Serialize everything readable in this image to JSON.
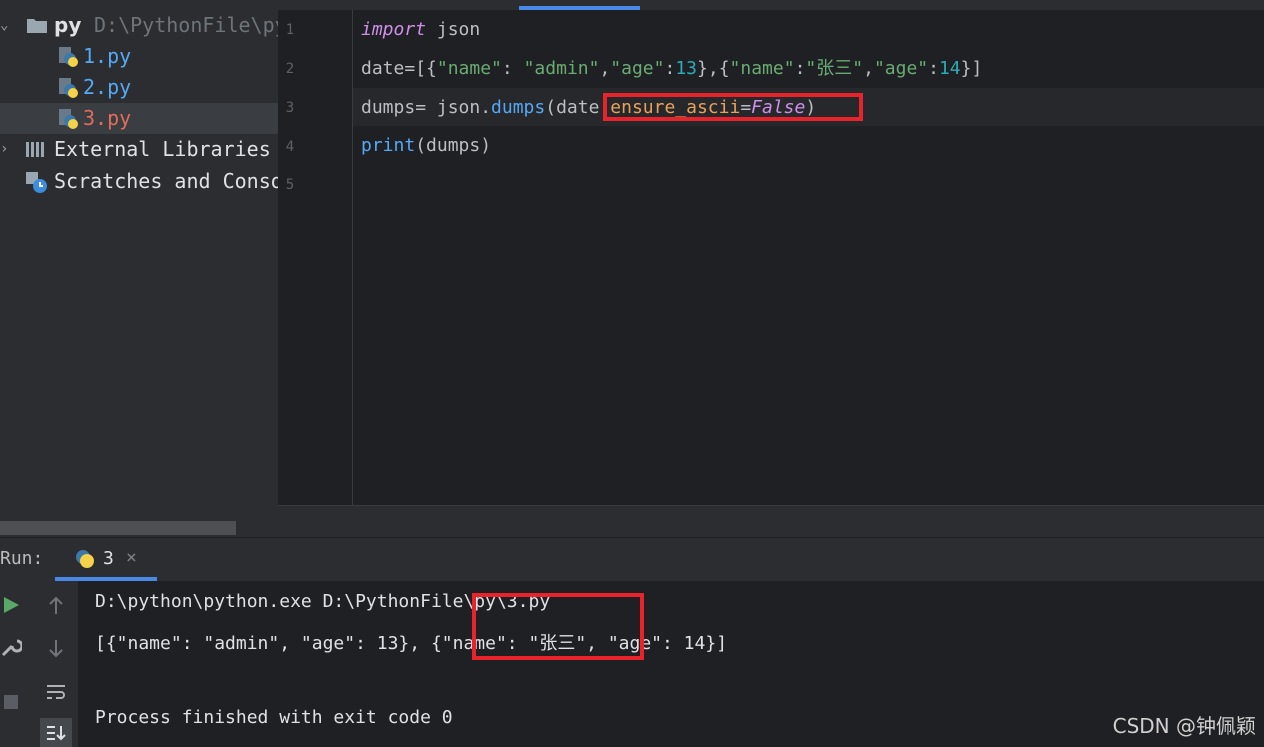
{
  "project": {
    "root_name": "py",
    "root_path": "D:\\PythonFile\\py",
    "files": [
      {
        "name": "1.py"
      },
      {
        "name": "2.py"
      },
      {
        "name": "3.py"
      }
    ],
    "external_libraries": "External Libraries",
    "scratches": "Scratches and Consoles"
  },
  "editor": {
    "line_numbers": [
      "1",
      "2",
      "3",
      "4",
      "5"
    ],
    "code": {
      "l1_kw": "import",
      "l1_rest": " json",
      "l2_a": "date",
      "l2_b": "=[{",
      "l2_s1": "\"name\"",
      "l2_c": ": ",
      "l2_s2": "\"admin\"",
      "l2_d": ",",
      "l2_s3": "\"age\"",
      "l2_e": ":",
      "l2_n1": "13",
      "l2_f": "},{",
      "l2_s4": "\"name\"",
      "l2_g": ":",
      "l2_s5": "\"张三\"",
      "l2_h": ",",
      "l2_s6": "\"age\"",
      "l2_i": ":",
      "l2_n2": "14",
      "l2_j": "}]",
      "l3_a": "dumps",
      "l3_b": "= json.",
      "l3_fn": "dumps",
      "l3_c": "(date,",
      "l3_param": "ensure_ascii",
      "l3_d": "=",
      "l3_kw": "False",
      "l3_e": ")",
      "l4_fn": "print",
      "l4_rest": "(dumps)"
    }
  },
  "run": {
    "label": "Run:",
    "tab_name": "3",
    "console_lines": [
      "D:\\python\\python.exe D:\\PythonFile\\py\\3.py",
      "[{\"name\": \"admin\", \"age\": 13}, {\"name\": \"张三\", \"age\": 14}]",
      "",
      "Process finished with exit code 0"
    ]
  },
  "watermark": "CSDN @钟佩颖",
  "colors": {
    "highlight_box": "#e8232b",
    "accent": "#4a88e8"
  }
}
